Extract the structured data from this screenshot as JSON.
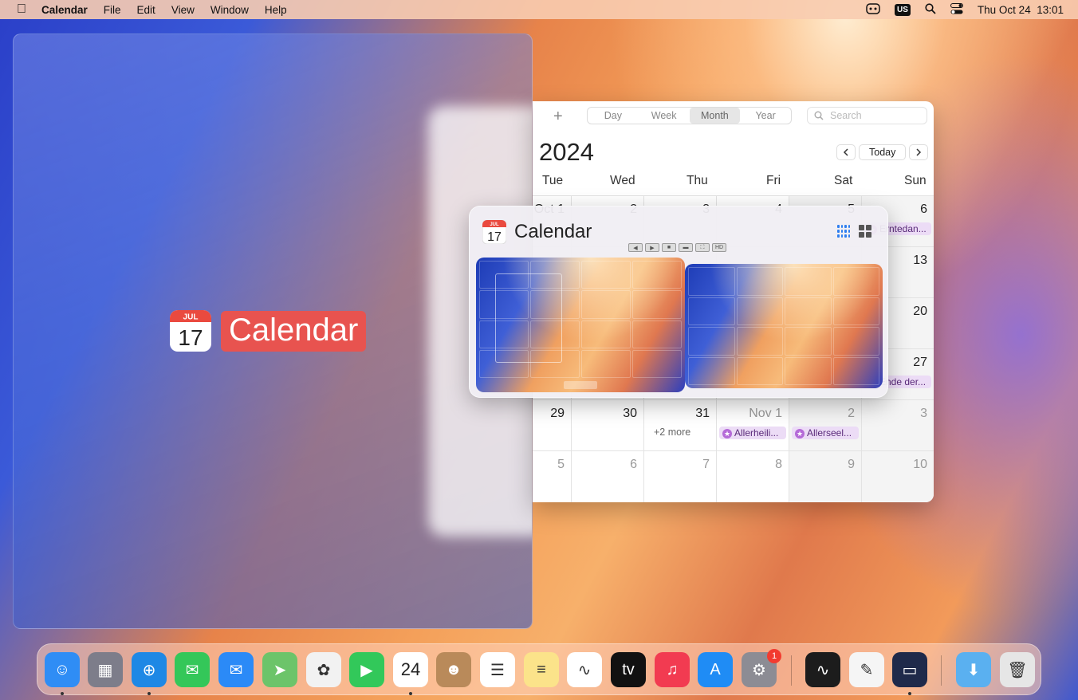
{
  "menubar": {
    "app_name": "Calendar",
    "items": [
      "File",
      "Edit",
      "View",
      "Window",
      "Help"
    ],
    "keyboard_layout": "US",
    "datetime": "Thu Oct 24  13:01"
  },
  "ghost": {
    "icon_month": "JUL",
    "icon_day": "17",
    "label": "Calendar"
  },
  "calendar": {
    "views": [
      "Day",
      "Week",
      "Month",
      "Year"
    ],
    "active_view": "Month",
    "search_placeholder": "Search",
    "month_title": "2024",
    "today_label": "Today",
    "weekdays": [
      "Tue",
      "Wed",
      "Thu",
      "Fri",
      "Sat",
      "Sun"
    ],
    "rows": [
      {
        "days": [
          "Oct 1",
          "2",
          "3",
          "4",
          "5",
          "6"
        ],
        "events": {
          "5": "Erntedan..."
        }
      },
      {
        "days": [
          "",
          "",
          "",
          "",
          "",
          "13"
        ],
        "events": {}
      },
      {
        "days": [
          "",
          "",
          "",
          "",
          "",
          "20"
        ],
        "events": {}
      },
      {
        "days": [
          "",
          "",
          "",
          "",
          "",
          "27"
        ],
        "events": {
          "5": "Ende der..."
        }
      },
      {
        "days": [
          "29",
          "30",
          "31",
          "Nov 1",
          "2",
          "3"
        ],
        "events": {
          "2": "+2 more",
          "3": "Allerheili...",
          "4": "Allerseel..."
        }
      },
      {
        "days": [
          "5",
          "6",
          "7",
          "8",
          "9",
          "10"
        ],
        "events": {}
      }
    ]
  },
  "switcher": {
    "icon_month": "JUL",
    "icon_day": "17",
    "title": "Calendar",
    "controls": [
      "◀",
      "▶",
      "■",
      "▬",
      "⛶",
      "HD"
    ]
  },
  "dock": {
    "apps": [
      {
        "name": "Finder",
        "icon": "finder-icon",
        "color": "#2f8df5",
        "glyph": "☺",
        "running": true
      },
      {
        "name": "Launchpad",
        "icon": "launchpad-icon",
        "color": "#7d7d8a",
        "glyph": "▦",
        "running": false
      },
      {
        "name": "Safari",
        "icon": "safari-icon",
        "color": "#1e88e5",
        "glyph": "⊕",
        "running": true
      },
      {
        "name": "Messages",
        "icon": "messages-icon",
        "color": "#34c759",
        "glyph": "✉",
        "running": false
      },
      {
        "name": "Mail",
        "icon": "mail-icon",
        "color": "#2b8af7",
        "glyph": "✉",
        "running": false
      },
      {
        "name": "Maps",
        "icon": "maps-icon",
        "color": "#6cc46a",
        "glyph": "➤",
        "running": false
      },
      {
        "name": "Photos",
        "icon": "photos-icon",
        "color": "#f2f2f2",
        "glyph": "✿",
        "running": false
      },
      {
        "name": "FaceTime",
        "icon": "facetime-icon",
        "color": "#32c85a",
        "glyph": "▶",
        "running": false
      },
      {
        "name": "Calendar",
        "icon": "calendar-icon",
        "color": "#ffffff",
        "glyph": "24",
        "running": true
      },
      {
        "name": "Contacts",
        "icon": "contacts-icon",
        "color": "#b98a5a",
        "glyph": "☻",
        "running": false
      },
      {
        "name": "Reminders",
        "icon": "reminders-icon",
        "color": "#ffffff",
        "glyph": "☰",
        "running": false
      },
      {
        "name": "Notes",
        "icon": "notes-icon",
        "color": "#fbe38a",
        "glyph": "≡",
        "running": false
      },
      {
        "name": "Freeform",
        "icon": "freeform-icon",
        "color": "#ffffff",
        "glyph": "∿",
        "running": false
      },
      {
        "name": "TV",
        "icon": "tv-icon",
        "color": "#111111",
        "glyph": "tv",
        "running": false
      },
      {
        "name": "Music",
        "icon": "music-icon",
        "color": "#f23b51",
        "glyph": "♫",
        "running": false
      },
      {
        "name": "App Store",
        "icon": "appstore-icon",
        "color": "#1f8cf5",
        "glyph": "A",
        "running": false
      },
      {
        "name": "System Settings",
        "icon": "settings-icon",
        "color": "#8c8c94",
        "glyph": "⚙",
        "running": false,
        "badge": "1"
      },
      {
        "name": "Activity Monitor",
        "icon": "activity-monitor-icon",
        "color": "#1c1c1c",
        "glyph": "∿",
        "running": false
      },
      {
        "name": "TextEdit",
        "icon": "textedit-icon",
        "color": "#f5f5f5",
        "glyph": "✎",
        "running": false
      },
      {
        "name": "Window",
        "icon": "window-icon",
        "color": "#1f2a4a",
        "glyph": "▭",
        "running": true
      },
      {
        "name": "Downloads",
        "icon": "downloads-folder-icon",
        "color": "#5ab0f0",
        "glyph": "⬇",
        "running": false
      },
      {
        "name": "Trash",
        "icon": "trash-icon",
        "color": "#e6e6e6",
        "glyph": "🗑",
        "running": false
      }
    ]
  }
}
